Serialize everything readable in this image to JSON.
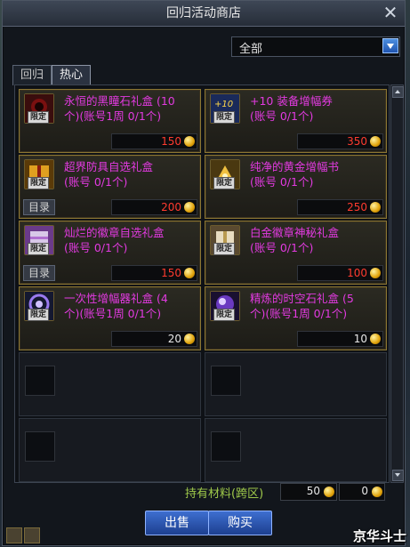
{
  "window": {
    "title": "回归活动商店",
    "close_icon": "close-icon"
  },
  "filter": {
    "selected": "全部"
  },
  "tabs": [
    {
      "label": "回归",
      "active": false
    },
    {
      "label": "热心",
      "active": true
    }
  ],
  "items": [
    {
      "name": "永恒的黑瞳石礼盒 (10\n个)(账号1周 0/1个)",
      "badge": "限定",
      "price": "150",
      "price_color": "#ff3b2f",
      "catalog": "",
      "icon": "black-stone-box-icon"
    },
    {
      "name": "+10 装备增幅券\n(账号 0/1个)",
      "badge": "限定",
      "price": "350",
      "price_color": "#ff3b2f",
      "catalog": "",
      "icon": "amplify-ticket-icon"
    },
    {
      "name": "超界防具自选礼盒\n(账号 0/1个)",
      "badge": "限定",
      "price": "200",
      "price_color": "#ff3b2f",
      "catalog": "目录",
      "icon": "armor-box-icon"
    },
    {
      "name": "纯净的黄金增幅书\n(账号 0/1个)",
      "badge": "限定",
      "price": "250",
      "price_color": "#ff3b2f",
      "catalog": "",
      "icon": "gold-book-icon"
    },
    {
      "name": "灿烂的徽章自选礼盒\n(账号 0/1个)",
      "badge": "限定",
      "price": "150",
      "price_color": "#ff3b2f",
      "catalog": "目录",
      "icon": "emblem-box-icon"
    },
    {
      "name": "白金徽章神秘礼盒\n(账号 0/1个)",
      "badge": "限定",
      "price": "100",
      "price_color": "#ff3b2f",
      "catalog": "",
      "icon": "platinum-box-icon"
    },
    {
      "name": "一次性增幅器礼盒 (4\n个)(账号1周 0/1个)",
      "badge": "限定",
      "price": "20",
      "price_color": "#e8e8e8",
      "catalog": "",
      "icon": "amplifier-box-icon"
    },
    {
      "name": "精炼的时空石礼盒 (5\n个)(账号1周 0/1个)",
      "badge": "限定",
      "price": "10",
      "price_color": "#e8e8e8",
      "catalog": "",
      "icon": "time-stone-box-icon"
    }
  ],
  "materials": {
    "label": "持有材料(跨区)",
    "amount": "50",
    "second_amount": "0"
  },
  "buttons": {
    "sell": "出售",
    "buy": "购买"
  },
  "watermark": "京华斗士"
}
